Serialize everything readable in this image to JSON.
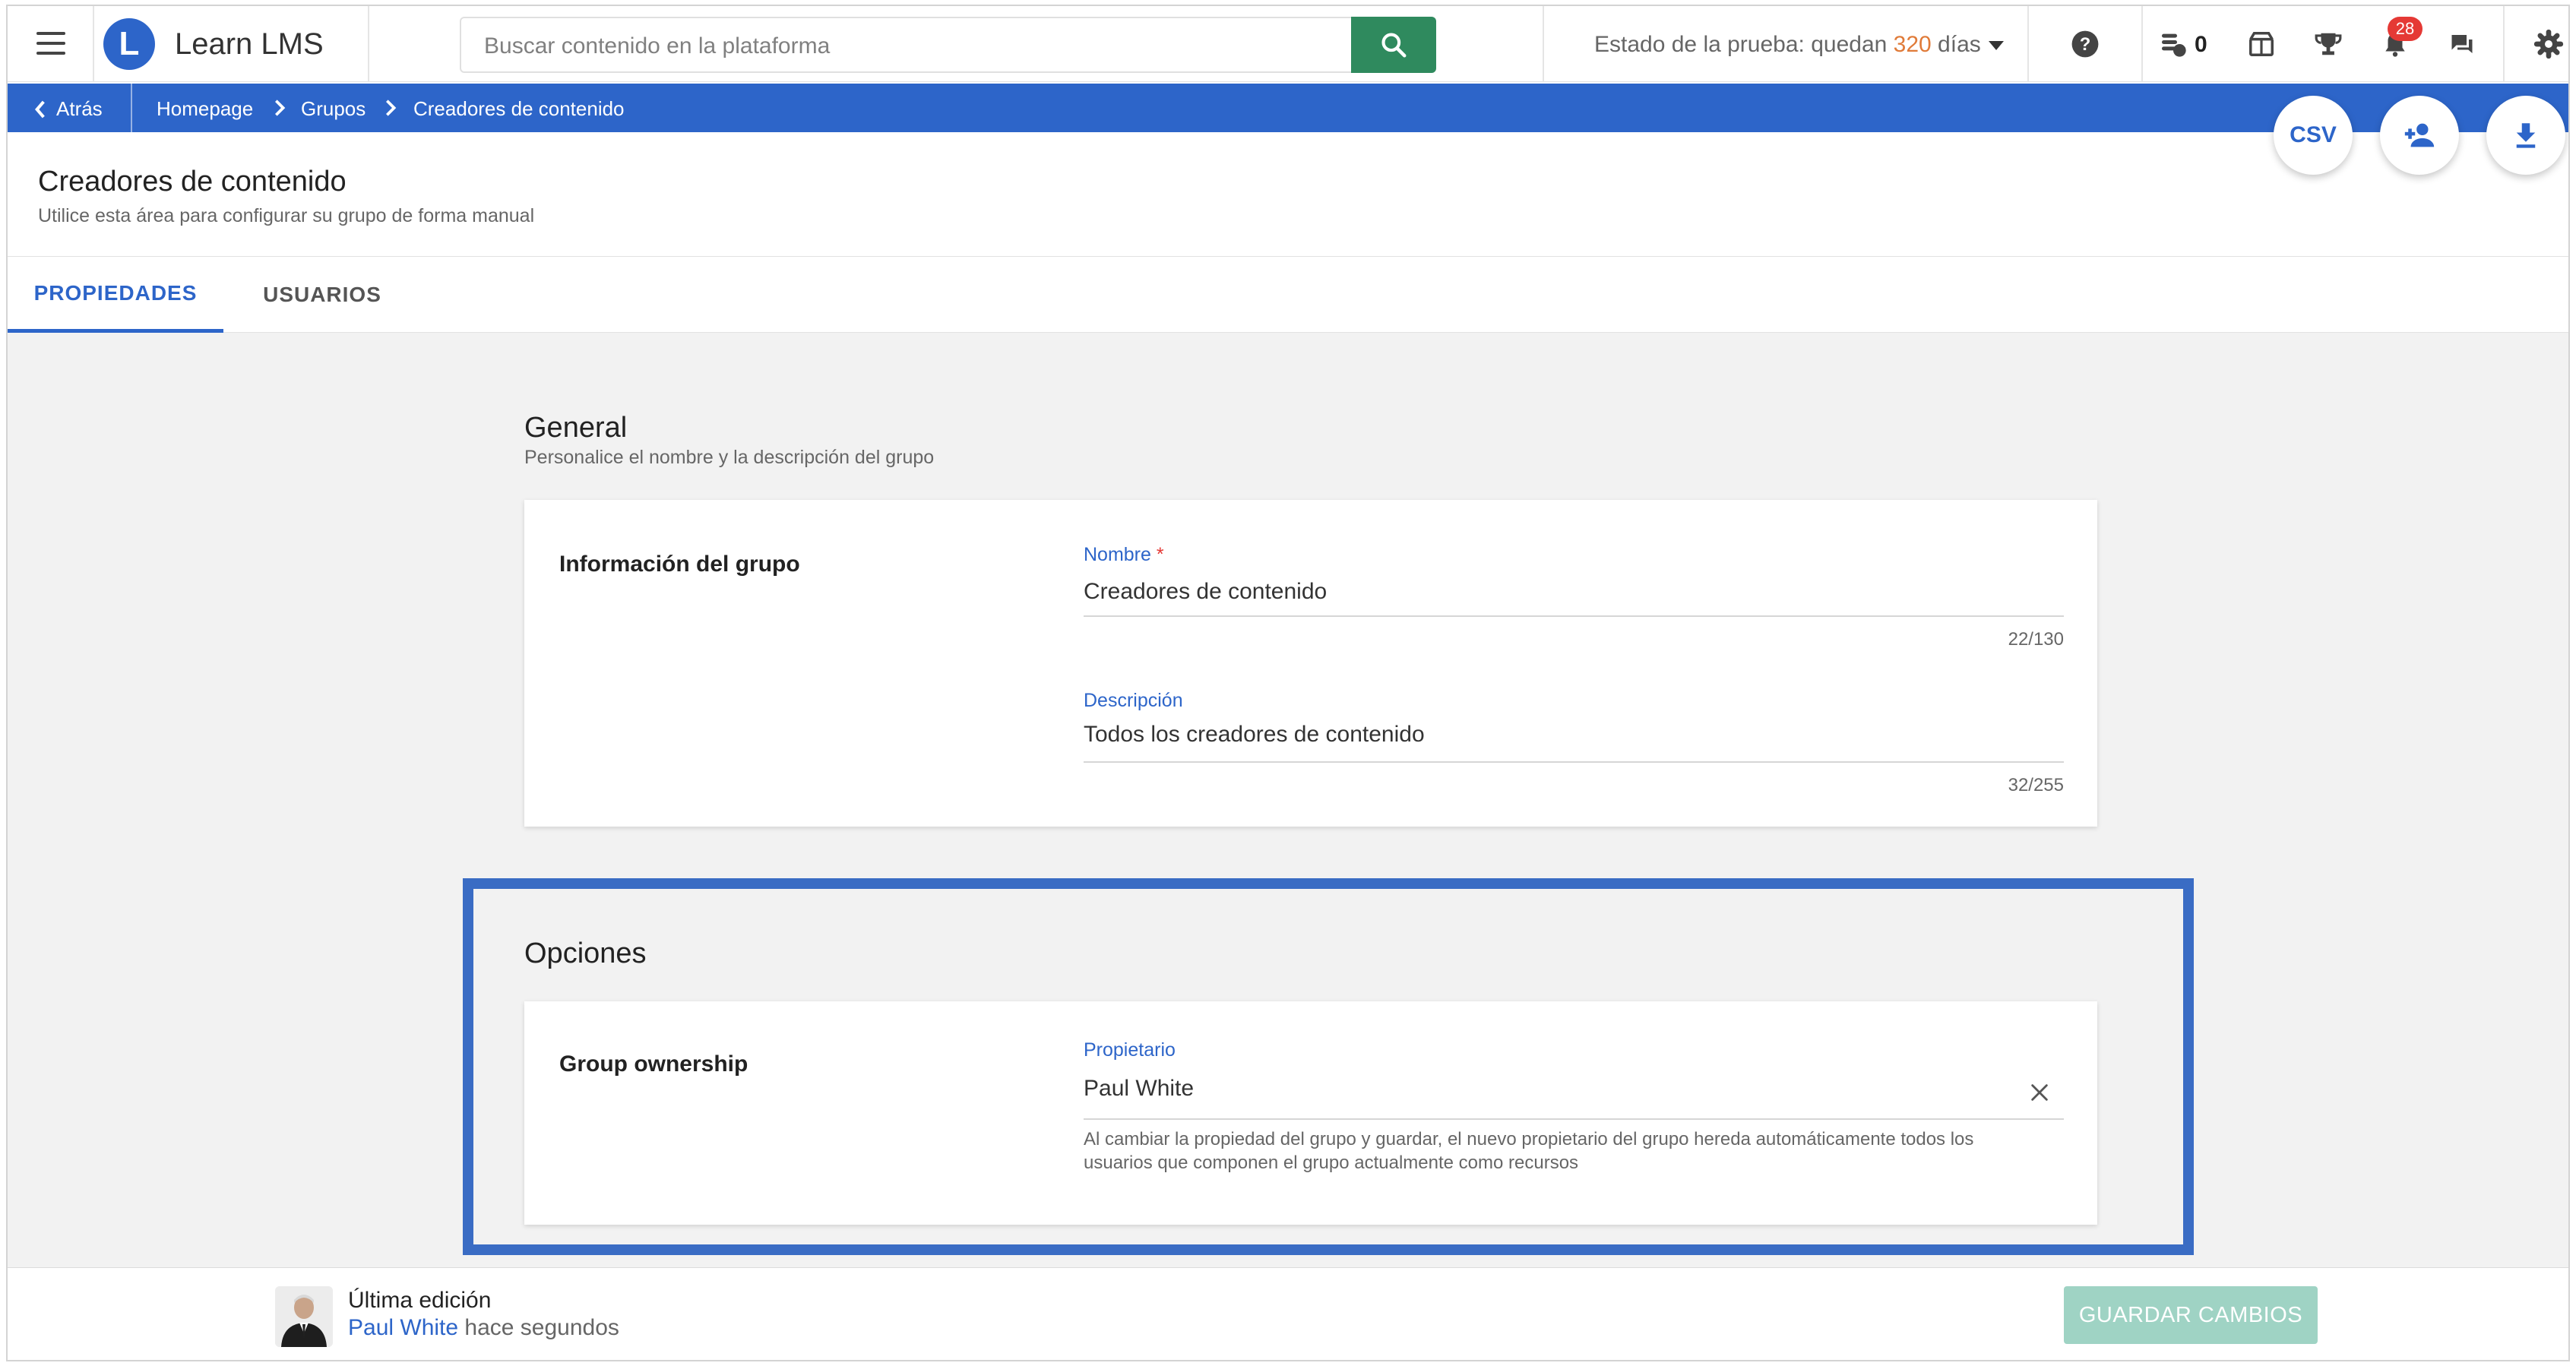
{
  "app": {
    "brand": "Learn LMS",
    "logo_letter": "L"
  },
  "search": {
    "placeholder": "Buscar contenido en la plataforma"
  },
  "trial": {
    "prefix": "Estado de la prueba: quedan ",
    "days": "320",
    "suffix": " días"
  },
  "topbar": {
    "credits": "0",
    "notifications_count": "28"
  },
  "icons": {
    "menu": "hamburger-icon",
    "search": "search-icon",
    "help": "help-icon",
    "credits": "coins-icon",
    "catalog": "store-icon",
    "trophy": "trophy-icon",
    "bell": "bell-icon",
    "chat": "chat-icon",
    "settings": "gear-icon",
    "back": "chevron-left-icon",
    "add_user": "add-user-icon",
    "download": "download-icon",
    "clear": "close-icon"
  },
  "breadcrumb": {
    "back": "Atrás",
    "items": [
      "Homepage",
      "Grupos",
      "Creadores de contenido"
    ]
  },
  "actions": {
    "csv": "CSV"
  },
  "header": {
    "title": "Creadores de contenido",
    "subtitle": "Utilice esta área para configurar su grupo de forma manual"
  },
  "tabs": [
    "PROPIEDADES",
    "USUARIOS"
  ],
  "general": {
    "title": "General",
    "subtitle": "Personalice el nombre y la descripción del grupo",
    "card_label": "Información del grupo",
    "name_label": "Nombre",
    "name_required": "*",
    "name_value": "Creadores de contenido",
    "name_count": "22/130",
    "desc_label": "Descripción",
    "desc_value": "Todos los creadores de contenido",
    "desc_count": "32/255"
  },
  "options": {
    "title": "Opciones",
    "card_label": "Group ownership",
    "owner_label": "Propietario",
    "owner_value": "Paul White",
    "help_line1": "Al cambiar la propiedad del grupo y guardar, el nuevo propietario del grupo hereda automáticamente todos los",
    "help_line2": "usuarios que componen el grupo actualmente como recursos"
  },
  "footer": {
    "edit_title": "Última edición",
    "editor": "Paul White",
    "edit_time": " hace segundos",
    "save": "GUARDAR CAMBIOS"
  },
  "colors": {
    "primary": "#2d65c9",
    "search_button": "#2f8a5e",
    "badge": "#e53935",
    "trial_days": "#e07b39",
    "save_disabled": "#9fd3c4",
    "highlight_border": "#3a6cc4"
  }
}
